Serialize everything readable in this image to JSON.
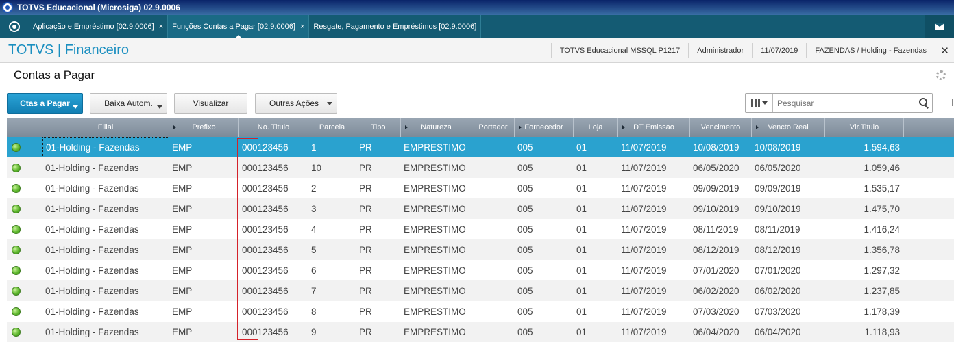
{
  "window": {
    "title": "TOTVS Educacional (Microsiga) 02.9.0006"
  },
  "tabs": [
    {
      "label": "Aplicação e Empréstimo [02.9.0006]",
      "active": false
    },
    {
      "label": "Funções Contas a Pagar [02.9.0006]",
      "active": true
    },
    {
      "label": "Resgate, Pagamento e Empréstimos [02.9.0006]",
      "active": false
    }
  ],
  "tab_close_glyph": "×",
  "module": {
    "title": "TOTVS | Financeiro",
    "environment": "TOTVS Educacional MSSQL P1217",
    "user": "Administrador",
    "date": "11/07/2019",
    "company": "FAZENDAS / Holding - Fazendas",
    "close_glyph": "✕"
  },
  "page": {
    "title": "Contas a Pagar"
  },
  "toolbar": {
    "ctas_label": "Ctas a Pagar",
    "baixa_label": "Baixa Autom.",
    "visualizar_label": "Visualizar",
    "outras_label": "Outras Ações"
  },
  "search": {
    "placeholder": "Pesquisar"
  },
  "grid": {
    "columns": [
      "",
      "Filial",
      "Prefixo",
      "No. Titulo",
      "Parcela",
      "Tipo",
      "Natureza",
      "Portador",
      "Fornecedor",
      "Loja",
      "DT Emissao",
      "Vencimento",
      "Vencto Real",
      "Vlr.Titulo"
    ],
    "rows": [
      {
        "filial": "01-Holding - Fazendas",
        "prefixo": "EMP",
        "titulo": "000123456",
        "parcela": "1",
        "tipo": "PR",
        "natureza": "EMPRESTIMO",
        "portador": "",
        "fornecedor": "005",
        "loja": "01",
        "emissao": "11/07/2019",
        "vencimento": "10/08/2019",
        "vencto_real": "10/08/2019",
        "valor": "1.594,63"
      },
      {
        "filial": "01-Holding - Fazendas",
        "prefixo": "EMP",
        "titulo": "000123456",
        "parcela": "10",
        "tipo": "PR",
        "natureza": "EMPRESTIMO",
        "portador": "",
        "fornecedor": "005",
        "loja": "01",
        "emissao": "11/07/2019",
        "vencimento": "06/05/2020",
        "vencto_real": "06/05/2020",
        "valor": "1.059,46"
      },
      {
        "filial": "01-Holding - Fazendas",
        "prefixo": "EMP",
        "titulo": "000123456",
        "parcela": "2",
        "tipo": "PR",
        "natureza": "EMPRESTIMO",
        "portador": "",
        "fornecedor": "005",
        "loja": "01",
        "emissao": "11/07/2019",
        "vencimento": "09/09/2019",
        "vencto_real": "09/09/2019",
        "valor": "1.535,17"
      },
      {
        "filial": "01-Holding - Fazendas",
        "prefixo": "EMP",
        "titulo": "000123456",
        "parcela": "3",
        "tipo": "PR",
        "natureza": "EMPRESTIMO",
        "portador": "",
        "fornecedor": "005",
        "loja": "01",
        "emissao": "11/07/2019",
        "vencimento": "09/10/2019",
        "vencto_real": "09/10/2019",
        "valor": "1.475,70"
      },
      {
        "filial": "01-Holding - Fazendas",
        "prefixo": "EMP",
        "titulo": "000123456",
        "parcela": "4",
        "tipo": "PR",
        "natureza": "EMPRESTIMO",
        "portador": "",
        "fornecedor": "005",
        "loja": "01",
        "emissao": "11/07/2019",
        "vencimento": "08/11/2019",
        "vencto_real": "08/11/2019",
        "valor": "1.416,24"
      },
      {
        "filial": "01-Holding - Fazendas",
        "prefixo": "EMP",
        "titulo": "000123456",
        "parcela": "5",
        "tipo": "PR",
        "natureza": "EMPRESTIMO",
        "portador": "",
        "fornecedor": "005",
        "loja": "01",
        "emissao": "11/07/2019",
        "vencimento": "08/12/2019",
        "vencto_real": "08/12/2019",
        "valor": "1.356,78"
      },
      {
        "filial": "01-Holding - Fazendas",
        "prefixo": "EMP",
        "titulo": "000123456",
        "parcela": "6",
        "tipo": "PR",
        "natureza": "EMPRESTIMO",
        "portador": "",
        "fornecedor": "005",
        "loja": "01",
        "emissao": "11/07/2019",
        "vencimento": "07/01/2020",
        "vencto_real": "07/01/2020",
        "valor": "1.297,32"
      },
      {
        "filial": "01-Holding - Fazendas",
        "prefixo": "EMP",
        "titulo": "000123456",
        "parcela": "7",
        "tipo": "PR",
        "natureza": "EMPRESTIMO",
        "portador": "",
        "fornecedor": "005",
        "loja": "01",
        "emissao": "11/07/2019",
        "vencimento": "06/02/2020",
        "vencto_real": "06/02/2020",
        "valor": "1.237,85"
      },
      {
        "filial": "01-Holding - Fazendas",
        "prefixo": "EMP",
        "titulo": "000123456",
        "parcela": "8",
        "tipo": "PR",
        "natureza": "EMPRESTIMO",
        "portador": "",
        "fornecedor": "005",
        "loja": "01",
        "emissao": "11/07/2019",
        "vencimento": "07/03/2020",
        "vencto_real": "07/03/2020",
        "valor": "1.178,39"
      },
      {
        "filial": "01-Holding - Fazendas",
        "prefixo": "EMP",
        "titulo": "000123456",
        "parcela": "9",
        "tipo": "PR",
        "natureza": "EMPRESTIMO",
        "portador": "",
        "fornecedor": "005",
        "loja": "01",
        "emissao": "11/07/2019",
        "vencimento": "06/04/2020",
        "vencto_real": "06/04/2020",
        "valor": "1.118,93"
      }
    ]
  },
  "colors": {
    "accent": "#2aa2cf",
    "tabbar": "#145b73",
    "status_green": "#5fb82e",
    "highlight": "#d4222a"
  }
}
